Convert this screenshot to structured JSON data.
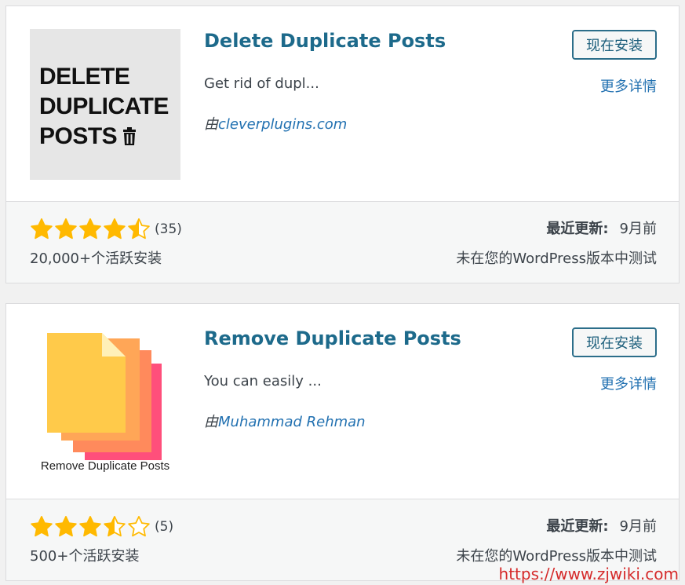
{
  "plugins": [
    {
      "title": "Delete Duplicate Posts",
      "description": "Get rid of dupl...",
      "author_prefix": "由",
      "author": "cleverplugins.com",
      "install_button": "现在安装",
      "more_details": "更多详情",
      "thumbnail_text": [
        "DELETE",
        "DUPLICATE",
        "POSTS"
      ],
      "rating": 4.5,
      "rating_count": "(35)",
      "active_installs": "20,000+个活跃安装",
      "last_updated_label": "最近更新:",
      "last_updated": "9月前",
      "compatibility": "未在您的WordPress版本中测试"
    },
    {
      "title": "Remove Duplicate Posts",
      "description": "You can easily ...",
      "author_prefix": "由",
      "author": "Muhammad Rehman",
      "install_button": "现在安装",
      "more_details": "更多详情",
      "thumbnail_text": "Remove Duplicate Posts",
      "rating": 3.5,
      "rating_count": "(5)",
      "active_installs": "500+个活跃安装",
      "last_updated_label": "最近更新:",
      "last_updated": "9月前",
      "compatibility": "未在您的WordPress版本中测试"
    }
  ],
  "watermark": "https://www.zjwiki.com",
  "colors": {
    "star": "#ffb900",
    "link": "#2271b1",
    "title": "#1d6a8b"
  }
}
